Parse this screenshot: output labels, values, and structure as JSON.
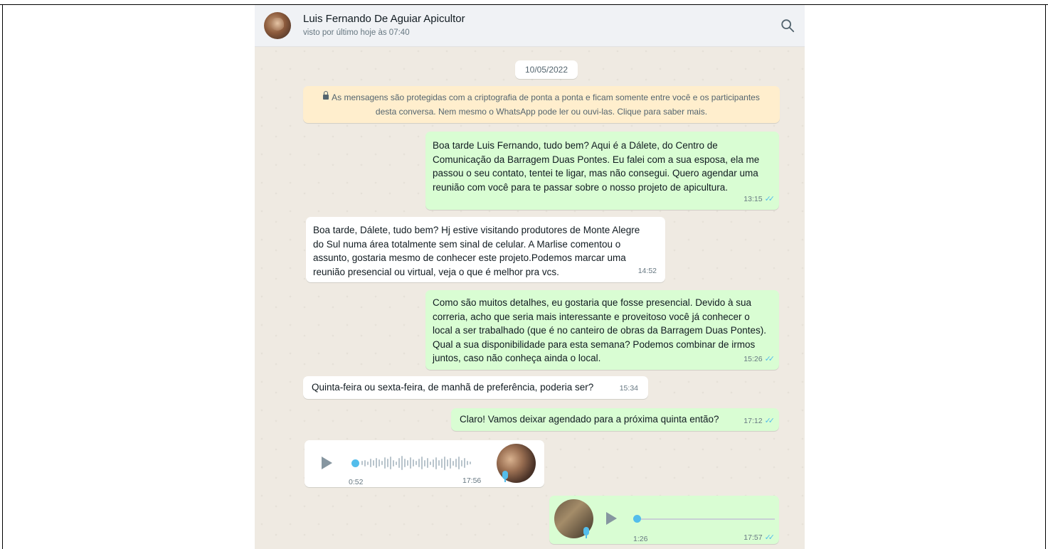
{
  "header": {
    "contact_name": "Luis Fernando De Aguiar Apicultor",
    "last_seen": "visto por último hoje às 07:40"
  },
  "date_chip": "10/05/2022",
  "encryption_notice": {
    "line1": "As mensagens são protegidas com a criptografia de ponta a ponta e ficam somente entre você e os participantes",
    "line2": "desta conversa. Nem mesmo o WhatsApp pode ler ou ouvi-las. Clique para saber mais."
  },
  "messages": [
    {
      "direction": "out",
      "text": "Boa tarde Luis Fernando, tudo bem? Aqui é a Dálete, do Centro de\nComunicação da Barragem Duas Pontes. Eu falei com a sua esposa, ela me\npassou o seu contato, tentei te ligar, mas não consegui. Quero agendar uma\nreunião com você para te passar sobre o nosso projeto de apicultura.",
      "time": "13:15",
      "read": true
    },
    {
      "direction": "in",
      "text": "Boa tarde, Dálete, tudo bem? Hj estive visitando produtores de Monte Alegre\ndo Sul numa área totalmente sem sinal de celular. A Marlise comentou o\nassunto, gostaria mesmo de conhecer este projeto.Podemos marcar uma\nreunião presencial ou virtual, veja o que é melhor pra vcs.",
      "time": "14:52"
    },
    {
      "direction": "out",
      "text": "Como são muitos detalhes, eu gostaria que fosse presencial. Devido à sua\ncorreria, acho que seria mais interessante e proveitoso você já conhecer o\nlocal a ser trabalhado (que é no canteiro de obras da Barragem Duas Pontes).\nQual a sua disponibilidade para esta semana? Podemos combinar de irmos\njuntos, caso não conheça ainda o local.",
      "time": "15:26",
      "read": true
    },
    {
      "direction": "in",
      "text": "Quinta-feira ou sexta-feira, de manhã de preferência, poderia ser?",
      "time": "15:34"
    },
    {
      "direction": "out",
      "text": "Claro! Vamos deixar agendado para a próxima quinta então?",
      "time": "17:12",
      "read": true
    }
  ],
  "voice_messages": [
    {
      "direction": "in",
      "duration": "0:52",
      "time": "17:56"
    },
    {
      "direction": "out",
      "duration": "1:26",
      "time": "17:57",
      "read": true
    }
  ],
  "icons": {
    "search": "search-icon",
    "lock": "lock-icon",
    "read_receipt": "double-check-icon",
    "play": "play-icon",
    "mic": "mic-icon"
  },
  "colors": {
    "chat_background": "#efeae2",
    "outgoing_bubble": "#d9fdd3",
    "incoming_bubble": "#ffffff",
    "encryption_notice": "#ffeecd",
    "read_ticks": "#53bdeb"
  }
}
